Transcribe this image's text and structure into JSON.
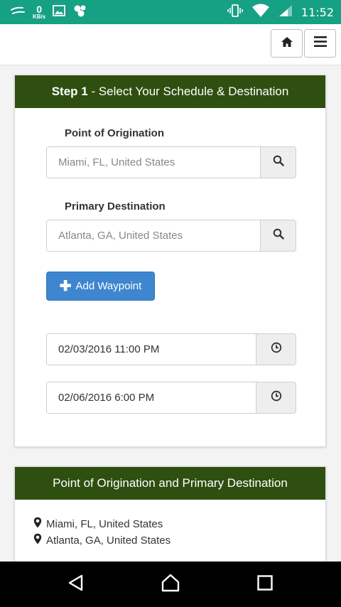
{
  "status_bar": {
    "net_speed_value": "0",
    "net_speed_unit": "KB/s",
    "time": "11:52",
    "icons": [
      "notification-icon",
      "image-icon",
      "app-icon",
      "vibrate-icon",
      "wifi-icon",
      "signal-icon"
    ]
  },
  "header": {
    "home_icon": "home-icon",
    "menu_icon": "hamburger-menu-icon"
  },
  "step1": {
    "title_bold": "Step 1",
    "title_rest": " - Select Your Schedule & Destination",
    "origin_label": "Point of Origination",
    "origin_placeholder": "Miami, FL, United States",
    "destination_label": "Primary Destination",
    "destination_placeholder": "Atlanta, GA, United States",
    "add_waypoint_label": "Add Waypoint",
    "start_datetime": "02/03/2016 11:00 PM",
    "end_datetime": "02/06/2016 6:00 PM"
  },
  "summary": {
    "title": "Point of Origination and Primary Destination",
    "locations": [
      "Miami, FL, United States",
      "Atlanta, GA, United States"
    ]
  },
  "colors": {
    "status_bar": "#16a084",
    "card_header": "#2f4f10",
    "primary_button": "#3e86cf"
  }
}
